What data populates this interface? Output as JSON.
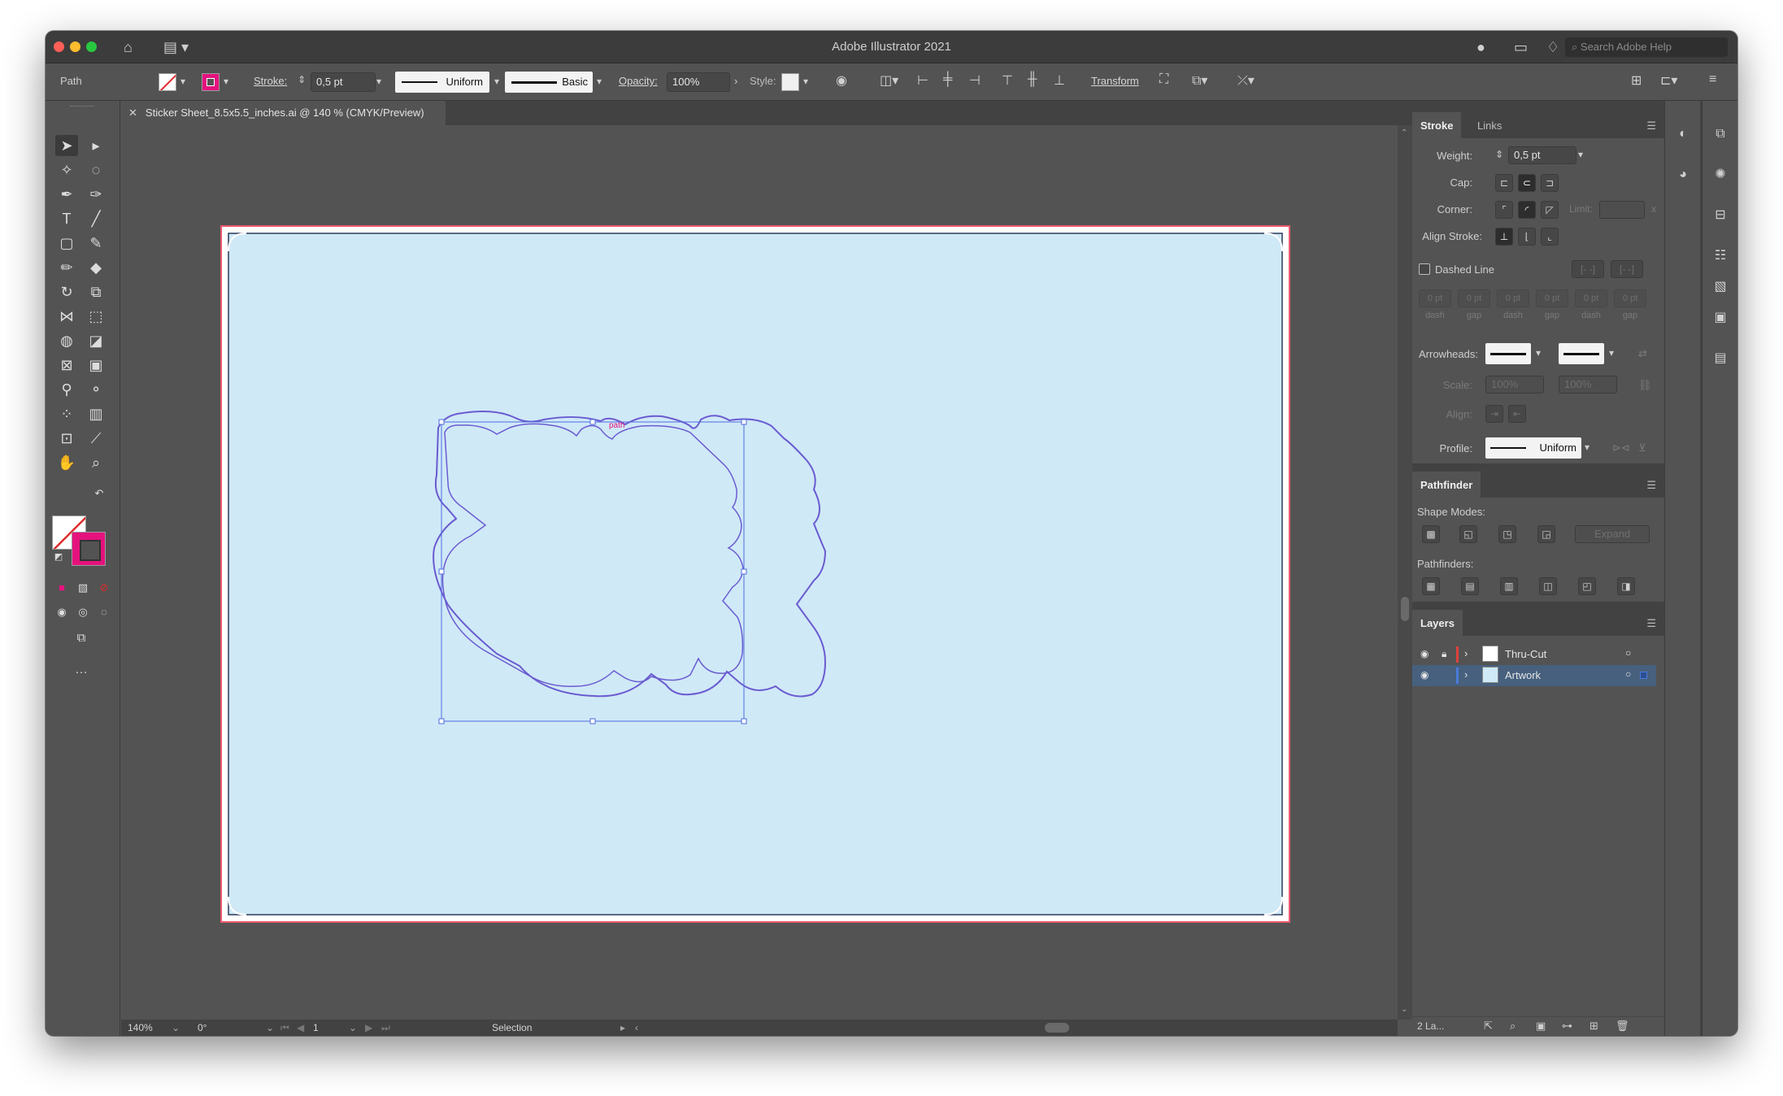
{
  "app": {
    "title": "Adobe Illustrator 2021",
    "search_placeholder": "Search Adobe Help"
  },
  "control_bar": {
    "selection_type": "Path",
    "stroke_label": "Stroke:",
    "stroke_weight": "0,5 pt",
    "stroke_profile": "Uniform",
    "brush": "Basic",
    "opacity_label": "Opacity:",
    "opacity_value": "100%",
    "style_label": "Style:",
    "transform_label": "Transform"
  },
  "document_tab": {
    "close_glyph": "✕",
    "title": "Sticker Sheet_8.5x5.5_inches.ai @ 140 % (CMYK/Preview)"
  },
  "canvas": {
    "artboard_color": "#cfe9f7",
    "path_color": "#6b5bd0",
    "smart_guide_label": "path",
    "accent_color": "#e5127e"
  },
  "status_bar": {
    "zoom": "140%",
    "rotation": "0°",
    "artboard_number": "1",
    "tool_name": "Selection"
  },
  "stroke_panel": {
    "tabs": [
      "Stroke",
      "Links"
    ],
    "weight_label": "Weight:",
    "weight_value": "0,5 pt",
    "cap_label": "Cap:",
    "corner_label": "Corner:",
    "limit_label": "Limit:",
    "limit_unit": "x",
    "align_stroke_label": "Align Stroke:",
    "dashed_line_label": "Dashed Line",
    "dash_fields": [
      {
        "value": "0 pt",
        "label": "dash"
      },
      {
        "value": "0 pt",
        "label": "gap"
      },
      {
        "value": "0 pt",
        "label": "dash"
      },
      {
        "value": "0 pt",
        "label": "gap"
      },
      {
        "value": "0 pt",
        "label": "dash"
      },
      {
        "value": "0 pt",
        "label": "gap"
      }
    ],
    "arrowheads_label": "Arrowheads:",
    "scale_label": "Scale:",
    "scale_values": [
      "100%",
      "100%"
    ],
    "align_label": "Align:",
    "profile_label": "Profile:",
    "profile_value": "Uniform"
  },
  "pathfinder_panel": {
    "title": "Pathfinder",
    "shape_modes_label": "Shape Modes:",
    "expand_label": "Expand",
    "pathfinders_label": "Pathfinders:"
  },
  "layers_panel": {
    "title": "Layers",
    "layers": [
      {
        "name": "Thru-Cut",
        "color": "#e0403c",
        "locked": true,
        "selected": false
      },
      {
        "name": "Artwork",
        "color": "#4a7bd8",
        "locked": false,
        "selected": true
      }
    ],
    "footer_count": "2 La..."
  }
}
